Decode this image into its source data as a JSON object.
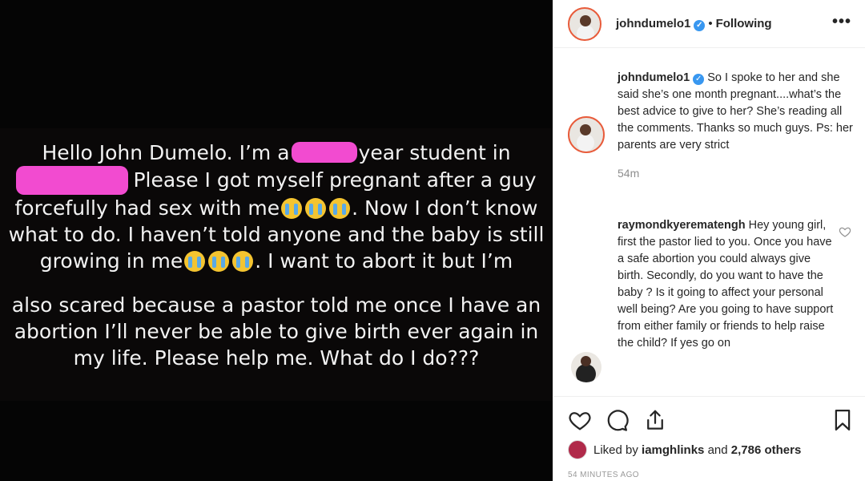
{
  "photo": {
    "line1a": "Hello John Dumelo. I’m a",
    "line1b": "year student in",
    "line2": "Please I got myself pregnant after a guy",
    "line3a": "forcefully had sex with me",
    "line3b": ". Now I don’t know",
    "line4": "what to do. I haven’t told anyone and the baby is still",
    "line5a": "growing in me",
    "line5b": ". I want to abort it but I’m",
    "line6": "also scared because a pastor told me once I have an",
    "line7": "abortion I’ll never be able to give birth ever again in",
    "line8": "my life. Please help me. What do I do???",
    "emoji": "loudly-crying-face-emoji",
    "redaction_color": "#f24bd0"
  },
  "header": {
    "username": "johndumelo1",
    "separator": "•",
    "follow_status": "Following",
    "more": "•••"
  },
  "caption": {
    "username": "johndumelo1",
    "text": "So I spoke to her and she said she’s one month pregnant....what’s the best advice to give to her? She’s reading all the comments. Thanks so much guys. Ps: her parents are very strict",
    "time": "54m"
  },
  "comment": {
    "username": "raymondkyerematengh",
    "text": "Hey young girl, first the pastor lied to you. Once you have a safe abortion you could always give birth. Secondly, do you want to have the baby ? Is it going to affect your personal well being? Are you going to have support from either family or friends to help raise the child? If yes go on"
  },
  "actions": {
    "icons": [
      "heart-icon",
      "comment-icon",
      "share-icon",
      "bookmark-icon"
    ],
    "liked_by_prefix": "Liked by",
    "liked_by_user": "iamghlinks",
    "liked_by_and": "and",
    "liked_by_others": "2,786 others",
    "posted_ago": "54 MINUTES AGO"
  },
  "colors": {
    "verified": "#3897f0",
    "story_ring": "#e85b3a"
  }
}
